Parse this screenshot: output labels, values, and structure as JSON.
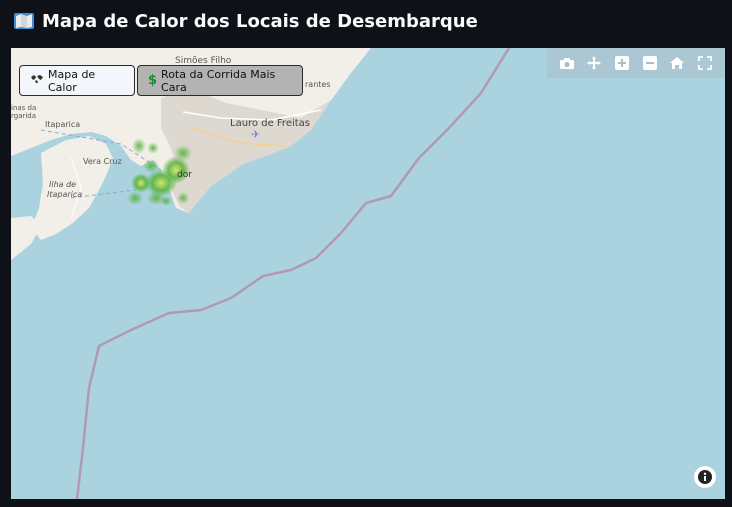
{
  "header": {
    "title": "Mapa de Calor dos Locais de Desembarque",
    "icon": "map-icon"
  },
  "buttons": {
    "heatmap": {
      "label": "Mapa de Calor",
      "icon": "world-map-icon"
    },
    "route": {
      "label": "Rota da Corrida Mais Cara",
      "icon": "dollar-sign-icon"
    }
  },
  "modebar": [
    "camera-icon",
    "pan-icon",
    "zoom-in-icon",
    "zoom-out-icon",
    "home-icon",
    "fullscreen-icon"
  ],
  "places": {
    "simoes_filho": "Simões Filho",
    "lauro": "Lauro de Freitas",
    "itaparica": "Itaparica",
    "vera_cruz": "Vera Cruz",
    "ilha1": "Ilha de",
    "ilha2": "Itaparica",
    "salvador_frag": "dor",
    "camacari_frag": "rantes",
    "cut1": "inas da",
    "cut2": "rgarida"
  },
  "colors": {
    "background": "#0e1117",
    "water": "#aad3df",
    "land": "#f2efe9",
    "urban": "#ddd8d0",
    "route_line": "#b19ab1",
    "heat_low": "#56b13b",
    "heat_high": "#d7e86a"
  }
}
